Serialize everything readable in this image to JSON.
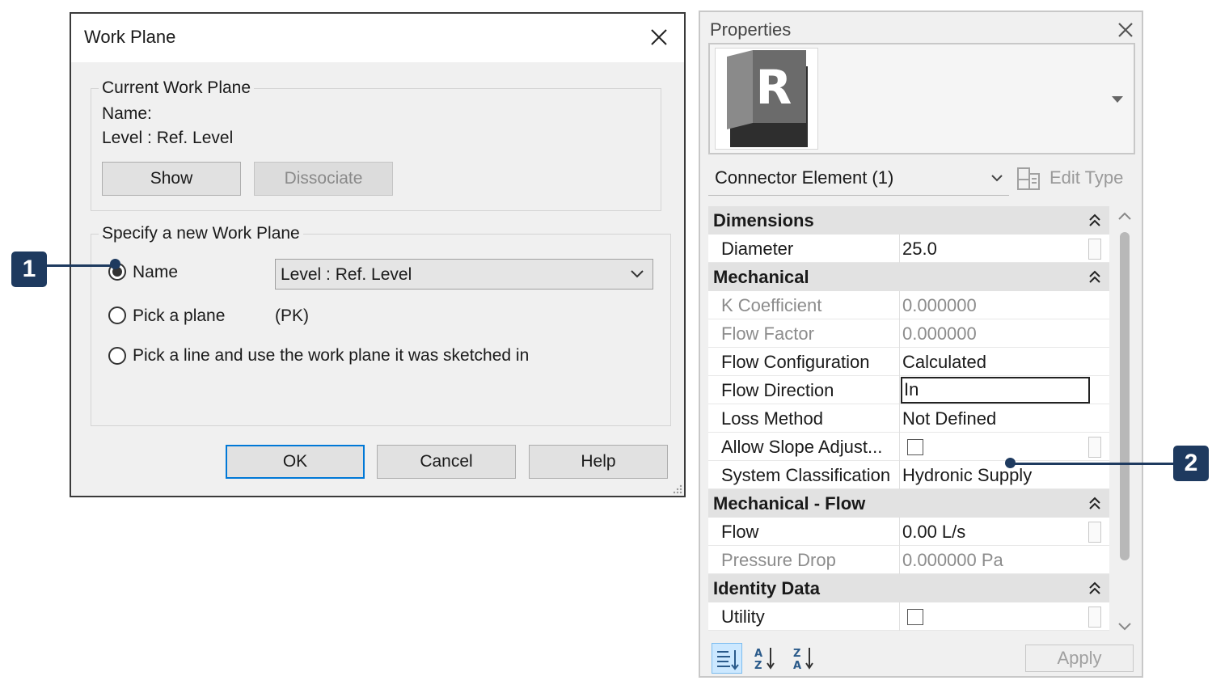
{
  "work_plane_dialog": {
    "title": "Work Plane",
    "current_group": {
      "legend": "Current Work Plane",
      "name_label": "Name:",
      "name_value": "Level : Ref. Level",
      "show_button": "Show",
      "dissociate_button": "Dissociate"
    },
    "specify_group": {
      "legend": "Specify a new Work Plane",
      "option_name": "Name",
      "option_name_selected": true,
      "name_dropdown_value": "Level : Ref. Level",
      "option_pick_plane": "Pick a plane",
      "pick_plane_shortcut": "(PK)",
      "option_pick_line": "Pick a line and use the work plane it was sketched in"
    },
    "buttons": {
      "ok": "OK",
      "cancel": "Cancel",
      "help": "Help"
    }
  },
  "properties_panel": {
    "title": "Properties",
    "type_logo_letter": "R",
    "element_filter": "Connector Element (1)",
    "edit_type_label": "Edit Type",
    "sections": [
      {
        "name": "Dimensions",
        "rows": [
          {
            "label": "Diameter",
            "value": "25.0",
            "dim": false
          }
        ]
      },
      {
        "name": "Mechanical",
        "rows": [
          {
            "label": "K Coefficient",
            "value": "0.000000",
            "dim": true
          },
          {
            "label": "Flow Factor",
            "value": "0.000000",
            "dim": true
          },
          {
            "label": "Flow Configuration",
            "value": "Calculated",
            "dim": false
          },
          {
            "label": "Flow Direction",
            "value": "In",
            "dim": false,
            "editing": true
          },
          {
            "label": "Loss Method",
            "value": "Not Defined",
            "dim": false
          },
          {
            "label": "Allow Slope Adjust...",
            "value": "",
            "checkbox": true,
            "checked": false
          },
          {
            "label": "System Classification",
            "value": "Hydronic Supply",
            "dim": false
          }
        ]
      },
      {
        "name": "Mechanical - Flow",
        "rows": [
          {
            "label": "Flow",
            "value": "0.00 L/s",
            "dim": false
          },
          {
            "label": "Pressure Drop",
            "value": "0.000000 Pa",
            "dim": true
          }
        ]
      },
      {
        "name": "Identity Data",
        "rows": [
          {
            "label": "Utility",
            "value": "",
            "checkbox": true,
            "checked": false
          }
        ]
      }
    ],
    "apply_button": "Apply"
  },
  "callouts": {
    "one": "1",
    "two": "2"
  },
  "colors": {
    "callout": "#1e3a5f",
    "focus_border": "#0078d7",
    "section_bg": "#e2e2e2"
  }
}
